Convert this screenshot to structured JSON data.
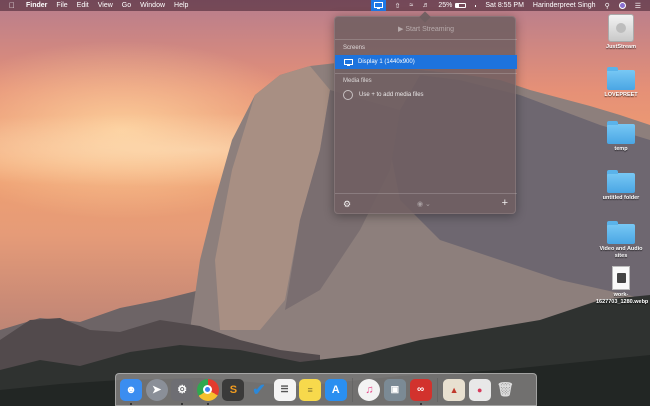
{
  "menubar": {
    "app_name": "Finder",
    "menus": [
      "File",
      "Edit",
      "View",
      "Go",
      "Window",
      "Help"
    ],
    "battery": "25%",
    "clock": "Sat 8:55 PM",
    "user": "Harinderpreet Singh"
  },
  "panel": {
    "start_streaming": "Start Streaming",
    "screens_header": "Screens",
    "display_item": "Display 1 (1440x900)",
    "media_header": "Media files",
    "media_hint": "Use + to add media files"
  },
  "desktop": {
    "icons": [
      {
        "label": "JustStream",
        "icon": "drive-icon"
      },
      {
        "label": "LOVEPREET",
        "icon": "folder-icon"
      },
      {
        "label": "temp",
        "icon": "folder-icon"
      },
      {
        "label": "untitled folder",
        "icon": "folder-icon"
      },
      {
        "label": "Video and Audio sites",
        "icon": "folder-icon"
      },
      {
        "label": "work-1627703_1280.webp",
        "icon": "document-icon"
      }
    ]
  },
  "dock": {
    "apps": [
      {
        "name": "finder-icon",
        "color": "#3b8df0"
      },
      {
        "name": "launchpad-icon",
        "color": "#8a8f98"
      },
      {
        "name": "system-preferences-icon",
        "color": "#6e6e73"
      },
      {
        "name": "chrome-icon",
        "color": "#e33b2e"
      },
      {
        "name": "sublime-text-icon",
        "color": "#f29c1f"
      },
      {
        "name": "wunderlist-icon",
        "color": "#2b88d9"
      },
      {
        "name": "reminders-icon",
        "color": "#f4f4f4"
      },
      {
        "name": "notes-icon",
        "color": "#f7d94c"
      },
      {
        "name": "app-store-icon",
        "color": "#2a8ff0"
      },
      {
        "name": "itunes-icon",
        "color": "#f3f3f3"
      },
      {
        "name": "photo-browser-icon",
        "color": "#7b8a95"
      },
      {
        "name": "creative-cloud-icon",
        "color": "#d2322d"
      },
      {
        "name": "document-viewer-icon",
        "color": "#e8e0d0"
      },
      {
        "name": "screen-recorder-icon",
        "color": "#e8e8e8"
      },
      {
        "name": "trash-icon",
        "color": "#9a9a9a"
      }
    ]
  }
}
